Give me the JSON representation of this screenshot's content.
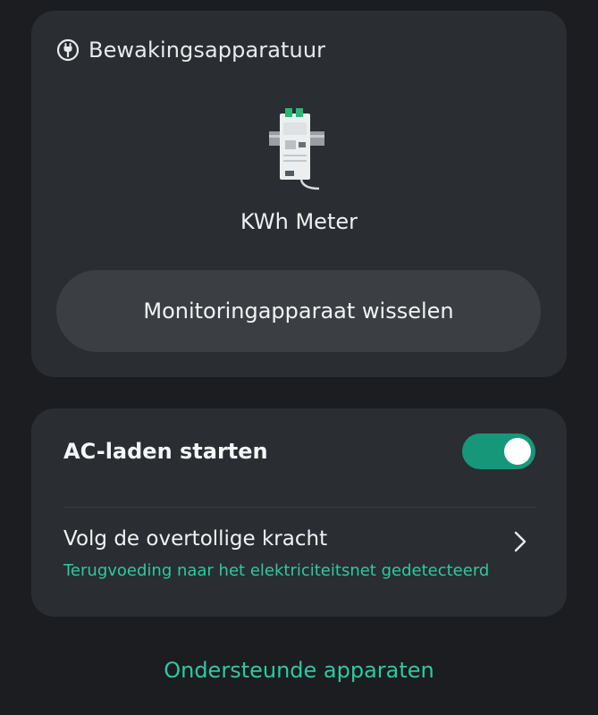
{
  "device_section": {
    "title": "Bewakingsapparatuur",
    "device_name": "KWh Meter",
    "switch_button_label": "Monitoringapparaat wisselen"
  },
  "settings": {
    "ac_charging_label": "AC-laden starten",
    "ac_charging_enabled": true,
    "surplus_title": "Volg de overtollige kracht",
    "surplus_status": "Terugvoeding naar het elektriciteitsnet gedetecteerd"
  },
  "footer": {
    "supported_devices_link": "Ondersteunde apparaten"
  },
  "colors": {
    "background": "#1b1d20",
    "card": "#2a2d31",
    "button": "#3b3e43",
    "accent": "#2ec9a3",
    "toggle_on": "#17977a"
  },
  "icons": {
    "header_icon": "plug-icon",
    "row_chevron": "chevron-right-icon"
  }
}
